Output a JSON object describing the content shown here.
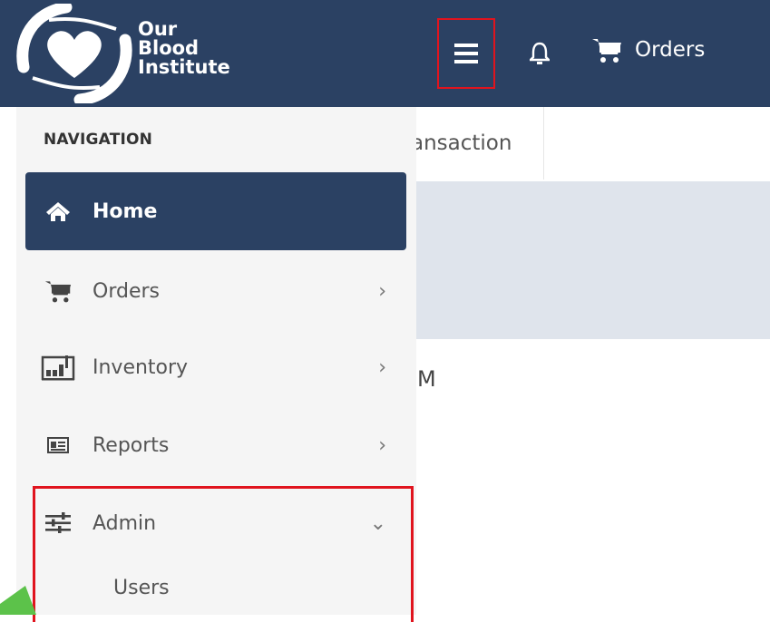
{
  "brand": {
    "line1": "Our",
    "line2": "Blood",
    "line3": "Institute"
  },
  "topbar": {
    "orders_label": "Orders"
  },
  "sidebar": {
    "heading": "NAVIGATION",
    "items": [
      {
        "label": "Home",
        "icon": "home-icon",
        "active": true
      },
      {
        "label": "Orders",
        "icon": "cart-icon"
      },
      {
        "label": "Inventory",
        "icon": "inventory-icon"
      },
      {
        "label": "Reports",
        "icon": "reports-icon"
      },
      {
        "label": "Admin",
        "icon": "sliders-icon",
        "expanded": true
      }
    ],
    "admin_sub": [
      "Users"
    ],
    "chevron_right": "›",
    "chevron_down": "⌄"
  },
  "content": {
    "tab_label": "ansaction",
    "fragment": "M"
  },
  "colors": {
    "navy": "#2b4163",
    "highlight": "#e0141e",
    "banner": "#dfe4ec"
  }
}
